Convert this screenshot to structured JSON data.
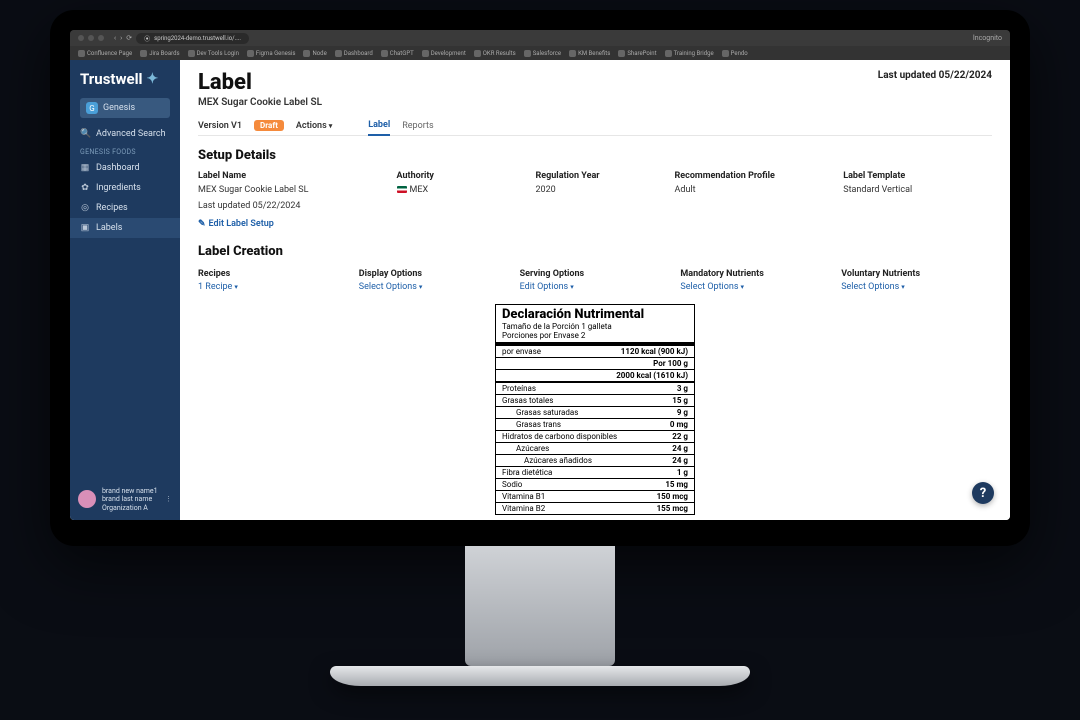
{
  "browser": {
    "url": "spring2024-demo.trustwell.io/....",
    "bookmarks": [
      "Confluence Page",
      "Jira Boards",
      "Dev Tools Login",
      "Figma Genesis",
      "Node",
      "Dashboard",
      "ChatGPT",
      "Development",
      "OKR Results",
      "Salesforce",
      "KM Benefits",
      "SharePoint",
      "Training Bridge",
      "Pendo"
    ],
    "incog": "Incognito"
  },
  "brand": "Trustwell",
  "sidebar": {
    "genesis": "Genesis",
    "search": "Advanced Search",
    "section": "Genesis Foods",
    "items": [
      "Dashboard",
      "Ingredients",
      "Recipes",
      "Labels"
    ],
    "user": {
      "line1": "brand new name1",
      "line2": "brand last name",
      "line3": "Organization A"
    }
  },
  "header": {
    "title": "Label",
    "subtitle": "MEX Sugar Cookie Label SL",
    "last_updated": "Last updated 05/22/2024",
    "version": "Version V1",
    "draft": "Draft",
    "actions": "Actions",
    "tabs": {
      "label": "Label",
      "reports": "Reports"
    }
  },
  "setup": {
    "title": "Setup Details",
    "labels": {
      "name": "Label Name",
      "authority": "Authority",
      "year": "Regulation Year",
      "profile": "Recommendation Profile",
      "template": "Label Template"
    },
    "values": {
      "name": "MEX Sugar Cookie Label SL",
      "authority": "MEX",
      "year": "2020",
      "profile": "Adult",
      "template": "Standard Vertical"
    },
    "foot": "Last updated 05/22/2024",
    "edit": "Edit Label Setup"
  },
  "creation": {
    "title": "Label Creation",
    "cols": {
      "recipes": {
        "title": "Recipes",
        "link": "1 Recipe"
      },
      "display": {
        "title": "Display Options",
        "link": "Select Options"
      },
      "serving": {
        "title": "Serving Options",
        "link": "Edit Options"
      },
      "mandatory": {
        "title": "Mandatory Nutrients",
        "link": "Select Options"
      },
      "voluntary": {
        "title": "Voluntary Nutrients",
        "link": "Select Options"
      }
    }
  },
  "nutri": {
    "title": "Declaración Nutrimental",
    "serving_label": "Tamaño de la Porción",
    "serving_val": "1 galleta",
    "per_container_label": "Porciones por Envase",
    "per_container_val": "2",
    "per_envase": "por envase",
    "energy1": "1120 kcal (900 kJ)",
    "per100": "Por 100 g",
    "energy2": "2000 kcal (1610 kJ)",
    "rows": [
      {
        "name": "Proteínas",
        "val": "3 g",
        "indent": 0
      },
      {
        "name": "Grasas totales",
        "val": "15 g",
        "indent": 0
      },
      {
        "name": "Grasas saturadas",
        "val": "9 g",
        "indent": 1
      },
      {
        "name": "Grasas trans",
        "val": "0 mg",
        "indent": 1
      },
      {
        "name": "Hidratos de carbono disponibles",
        "val": "22 g",
        "indent": 0
      },
      {
        "name": "Azúcares",
        "val": "24 g",
        "indent": 1
      },
      {
        "name": "Azúcares añadidos",
        "val": "24 g",
        "indent": 2
      },
      {
        "name": "Fibra dietética",
        "val": "1 g",
        "indent": 0
      },
      {
        "name": "Sodio",
        "val": "15 mg",
        "indent": 0
      },
      {
        "name": "Vitamina B1",
        "val": "150 mcg",
        "indent": 0
      },
      {
        "name": "Vitamina B2",
        "val": "155 mcg",
        "indent": 0
      }
    ]
  },
  "help": "?"
}
